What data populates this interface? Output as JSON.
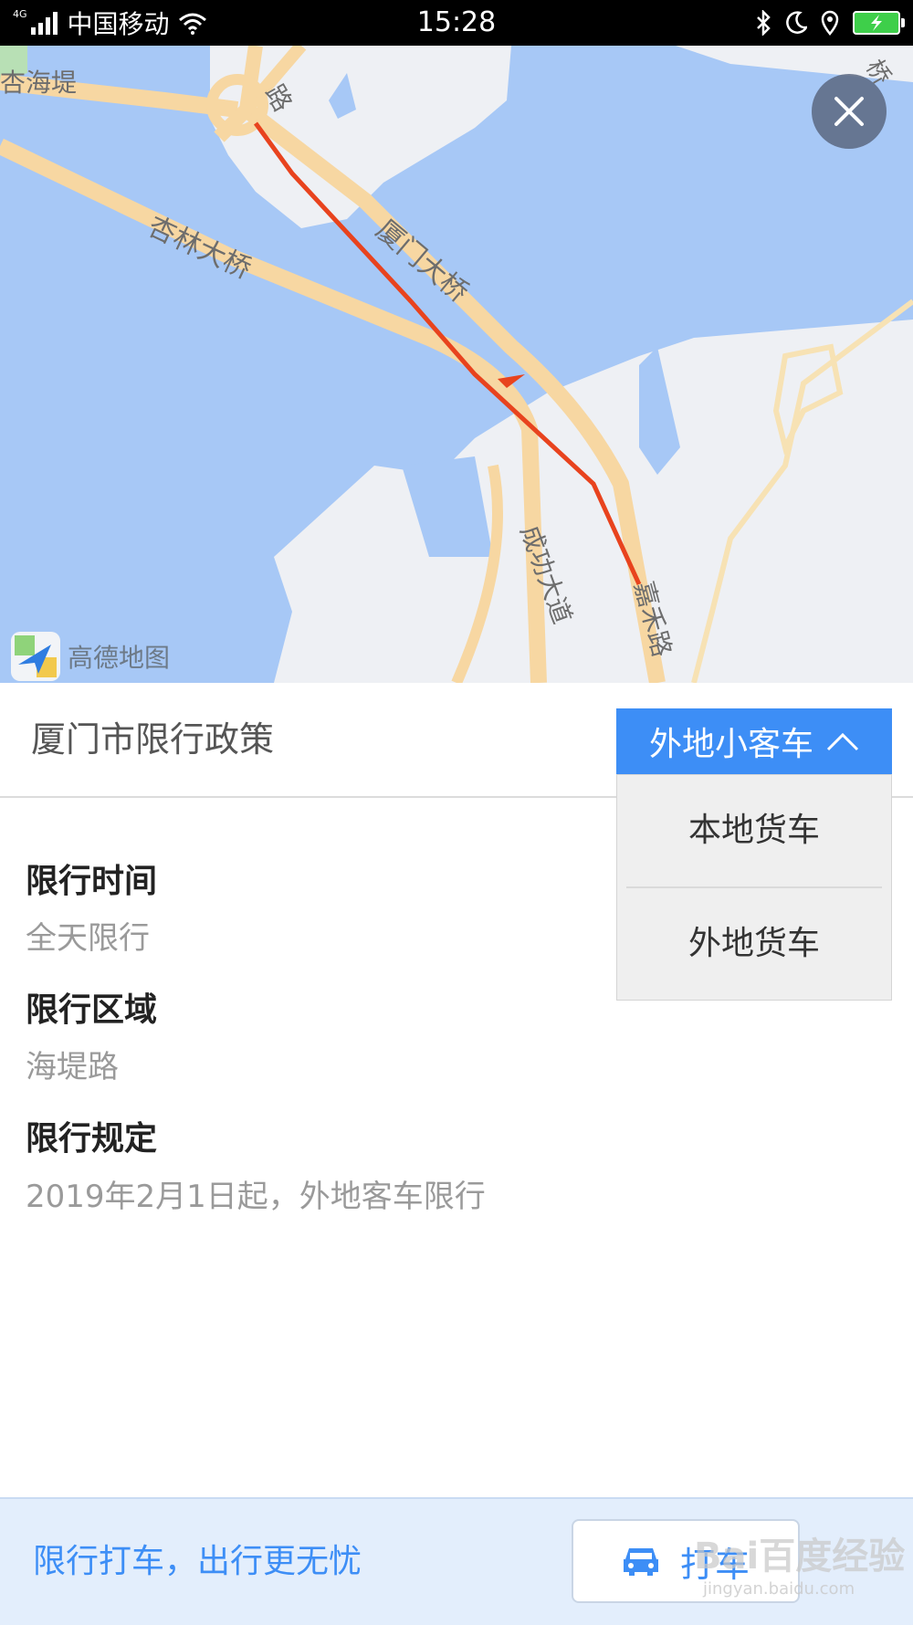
{
  "status_bar": {
    "network": "4G",
    "carrier": "中国移动",
    "time": "15:28"
  },
  "map": {
    "labels": {
      "haidi": "杏海堤",
      "lu_top": "路",
      "xinglin_bridge": "杏林大桥",
      "xiamen_bridge": "厦门大桥",
      "chenggong": "成功大道",
      "jiahe": "嘉禾路",
      "qiao_right": "桥"
    },
    "logo_text": "高德地图",
    "colors": {
      "water": "#a7c8f6",
      "land": "#eef0f4",
      "road": "#f7d7a2",
      "route": "#e8431e"
    }
  },
  "policy": {
    "title": "厦门市限行政策",
    "vehicle_select": {
      "selected": "外地小客车",
      "options": [
        "本地货车",
        "外地货车"
      ]
    },
    "sections": [
      {
        "title": "限行时间",
        "value": "全天限行"
      },
      {
        "title": "限行区域",
        "value": "海堤路"
      },
      {
        "title": "限行规定",
        "value": "2019年2月1日起，外地客车限行"
      }
    ]
  },
  "banner": {
    "text": "限行打车，出行更无忧",
    "taxi_button": "打车"
  },
  "watermark": {
    "main": "Bai百度经验",
    "sub": "jingyan.baidu.com"
  }
}
